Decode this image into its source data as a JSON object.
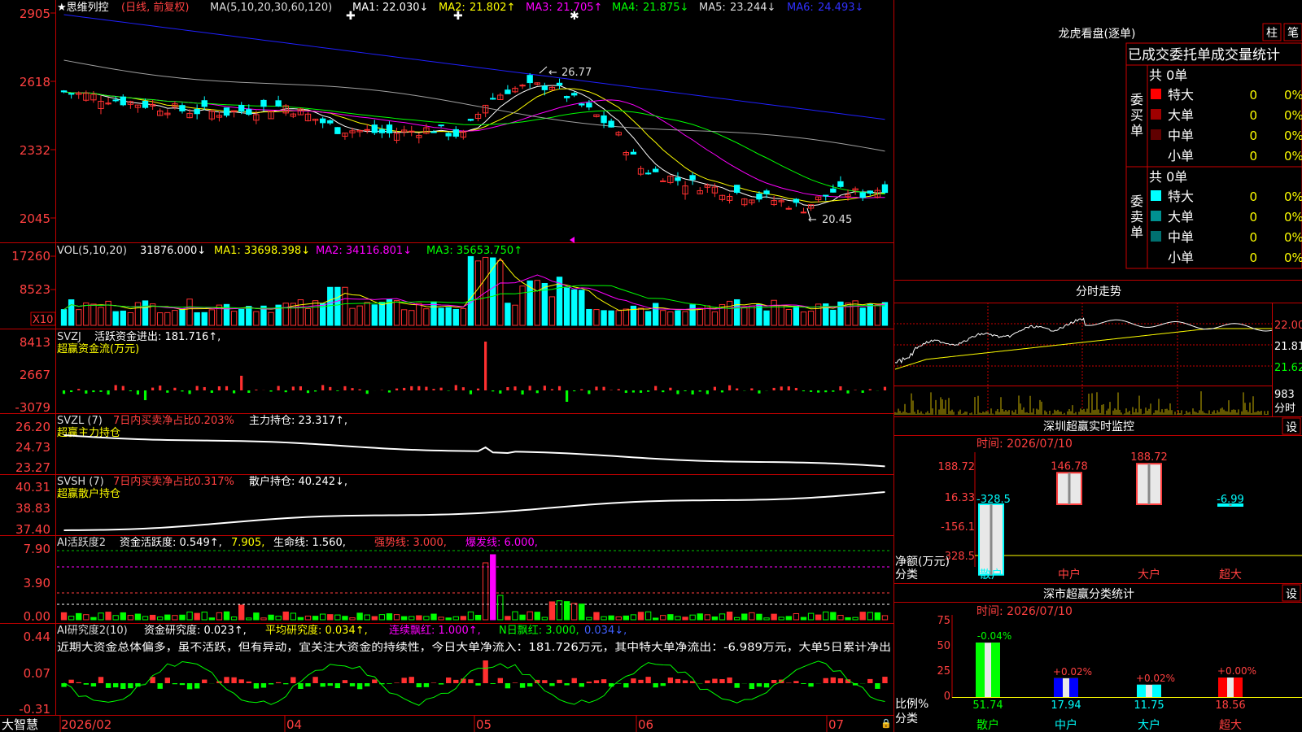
{
  "colors": {
    "up": "#ff3030",
    "down": "#00ffff",
    "frame": "#c00000",
    "ma1": "#ffffff",
    "ma2": "#ffff00",
    "ma3": "#ff00ff",
    "ma4": "#00ff00",
    "ma5": "#a0a0a0",
    "ma6": "#2020ff",
    "text_red": "#ff4040",
    "text_yellow": "#ffff00",
    "text_green": "#00ff00",
    "text_magenta": "#ff00ff"
  },
  "main": {
    "title": "★思维列控",
    "period": "(日线, 前复权)",
    "ma_label": "MA(5,10,20,30,60,120)",
    "ma": [
      {
        "label": "MA1:",
        "value": "22.030↓",
        "color": "#ffffff"
      },
      {
        "label": "MA2:",
        "value": "21.802↑",
        "color": "#ffff00"
      },
      {
        "label": "MA3:",
        "value": "21.705↑",
        "color": "#ff00ff"
      },
      {
        "label": "MA4:",
        "value": "21.875↓",
        "color": "#00ff00"
      },
      {
        "label": "MA5:",
        "value": "23.244↓",
        "color": "#a0a0a0"
      },
      {
        "label": "MA6:",
        "value": "24.493↓",
        "color": "#2020ff"
      }
    ],
    "y_ticks": [
      "2905",
      "2618",
      "2332",
      "2045"
    ],
    "high_label": "26.77",
    "low_label": "20.45"
  },
  "vol": {
    "label": "VOL(5,10,20)",
    "value": "31876.000↓",
    "ma1": "MA1: 33698.398↓",
    "ma2": "MA2: 34116.801↓",
    "ma3": "MA3: 35653.750↑",
    "y_ticks": [
      "17260",
      "8523"
    ],
    "unit": "X10"
  },
  "svzj": {
    "label": "SVZJ",
    "desc": "活跃资金进出: 181.716↑,",
    "sub": "超赢资金流(万元)",
    "y_ticks": [
      "8413",
      "2667",
      "-3079"
    ]
  },
  "svzl": {
    "label": "SVZL (7)",
    "desc_red": "7日内买卖净占比0.203%",
    "desc": "主力持仓: 23.317↑,",
    "sub": "超赢主力持仓",
    "y_ticks": [
      "26.20",
      "24.73",
      "23.27"
    ]
  },
  "svsh": {
    "label": "SVSH (7)",
    "desc_red": "7日内买卖净占比0.317%",
    "desc": "散户持仓: 40.242↓,",
    "sub": "超赢散户持仓",
    "y_ticks": [
      "40.31",
      "38.83",
      "37.40"
    ]
  },
  "ai1": {
    "label": "AI活跃度2",
    "t1": "资金活跃度: 0.549↑,",
    "t2": "7.905,",
    "t3": "生命线: 1.560,",
    "t4": "强势线: 3.000,",
    "t5": "爆发线: 6.000,",
    "y_ticks": [
      "7.90",
      "3.90",
      "0.00"
    ]
  },
  "ai2": {
    "label": "AI研究度2(10)",
    "t1": "资金研究度: 0.023↑,",
    "t2": "平均研究度: 0.034↑,",
    "t3": "连续飘红: 1.000↑,",
    "t4": "N日飘红: 3.000,",
    "t5": "0.034↓,",
    "comment": "近期大资金总体偏多，虽不活跃，但有异动，宜关注大资金的持续性，今日大单净流入：181.726万元，其中特大单净流出：-6.989万元，大单5日累计净出",
    "y_ticks": [
      "0.44",
      "0.07",
      "-0.31"
    ]
  },
  "xaxis": {
    "brand": "大智慧",
    "labels": [
      "2026/02",
      "04",
      "05",
      "06",
      "07"
    ]
  },
  "right": {
    "lhb_title": "龙虎看盘(逐单)",
    "btn_zhu": "柱",
    "btn_bi": "笔",
    "stats_title": "已成交委托单成交量统计",
    "buy_label": "委买单",
    "sell_label": "委卖单",
    "buy_total": "共 0单",
    "sell_total": "共 0单",
    "buy_rows": [
      {
        "name": "特大",
        "count": "0",
        "pct": "0%",
        "color": "#ff0000"
      },
      {
        "name": "大单",
        "count": "0",
        "pct": "0%",
        "color": "#a00000"
      },
      {
        "name": "中单",
        "count": "0",
        "pct": "0%",
        "color": "#600000"
      },
      {
        "name": "小单",
        "count": "0",
        "pct": "0%",
        "color": "#000000"
      }
    ],
    "sell_rows": [
      {
        "name": "特大",
        "count": "0",
        "pct": "0%",
        "color": "#00ffff"
      },
      {
        "name": "大单",
        "count": "0",
        "pct": "0%",
        "color": "#009090"
      },
      {
        "name": "中单",
        "count": "0",
        "pct": "0%",
        "color": "#007070"
      },
      {
        "name": "小单",
        "count": "0",
        "pct": "0%",
        "color": "#000000"
      }
    ],
    "fs_title": "分时走势",
    "fs_y": [
      "22.00",
      "21.81",
      "21.62"
    ],
    "fs_vol": "983",
    "fs_unit": "分时",
    "sz_title": "深圳超赢实时监控",
    "sz_time": "时间: 2026/07/10",
    "sz_set": "设",
    "sz_y": [
      "188.72",
      "16.33",
      "-156.1",
      "-328.5"
    ],
    "sz_bars": [
      {
        "name": "散户",
        "value": -328.5,
        "label": "-328.5"
      },
      {
        "name": "中户",
        "value": 146.78,
        "label": "146.78"
      },
      {
        "name": "大户",
        "value": 188.72,
        "label": "188.72"
      },
      {
        "name": "超大",
        "value": -6.99,
        "label": "-6.99"
      }
    ],
    "sz_axis_label1": "净额(万元)",
    "sz_axis_label2": "分类",
    "cls_title": "深市超赢分类统计",
    "cls_time": "时间: 2026/07/10",
    "cls_set": "设",
    "cls_y": [
      "75",
      "50",
      "25",
      "0"
    ],
    "cls_bars": [
      {
        "name": "散户",
        "pct": 51.74,
        "change": "-0.04%",
        "value_label": "51.74"
      },
      {
        "name": "中户",
        "pct": 17.94,
        "change": "+0.02%",
        "value_label": "17.94"
      },
      {
        "name": "大户",
        "pct": 11.75,
        "change": "+0.02%",
        "value_label": "11.75"
      },
      {
        "name": "超大",
        "pct": 18.56,
        "change": "+0.00%",
        "value_label": "18.56"
      }
    ],
    "cls_axis_label1": "比例%",
    "cls_axis_label2": "分类"
  }
}
